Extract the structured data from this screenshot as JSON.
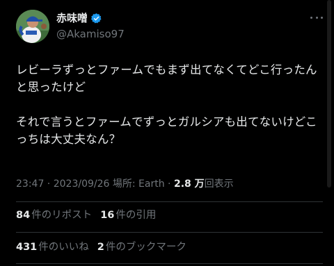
{
  "author": {
    "display_name": "赤味噌",
    "handle": "@Akamiso97",
    "verified_color": "#1d9bf0",
    "avatar_icon": "baseball-pitcher-avatar"
  },
  "tweet": {
    "text": "レビーラずっとファームでもまず出てなくてどこ行ったんと思ったけど\n\nそれで言うとファームでずっとガルシアも出てないけどこっちは大丈夫なん？",
    "time": "23:47",
    "separator1": " · ",
    "date": "2023/09/26",
    "location_label": " 場所: Earth",
    "separator2": " · ",
    "views_count": "2.8 万",
    "views_label": "回表示"
  },
  "stats": {
    "reposts_count": "84",
    "reposts_label": "件のリポスト",
    "quotes_count": "16",
    "quotes_label": "件の引用",
    "likes_count": "431",
    "likes_label": "件のいいね",
    "bookmarks_count": "2",
    "bookmarks_label": "件のブックマーク"
  },
  "colors": {
    "background": "#000000",
    "primary_text": "#e7e9ea",
    "secondary_text": "#71767b",
    "divider": "#2f3336",
    "accent": "#1d9bf0"
  }
}
